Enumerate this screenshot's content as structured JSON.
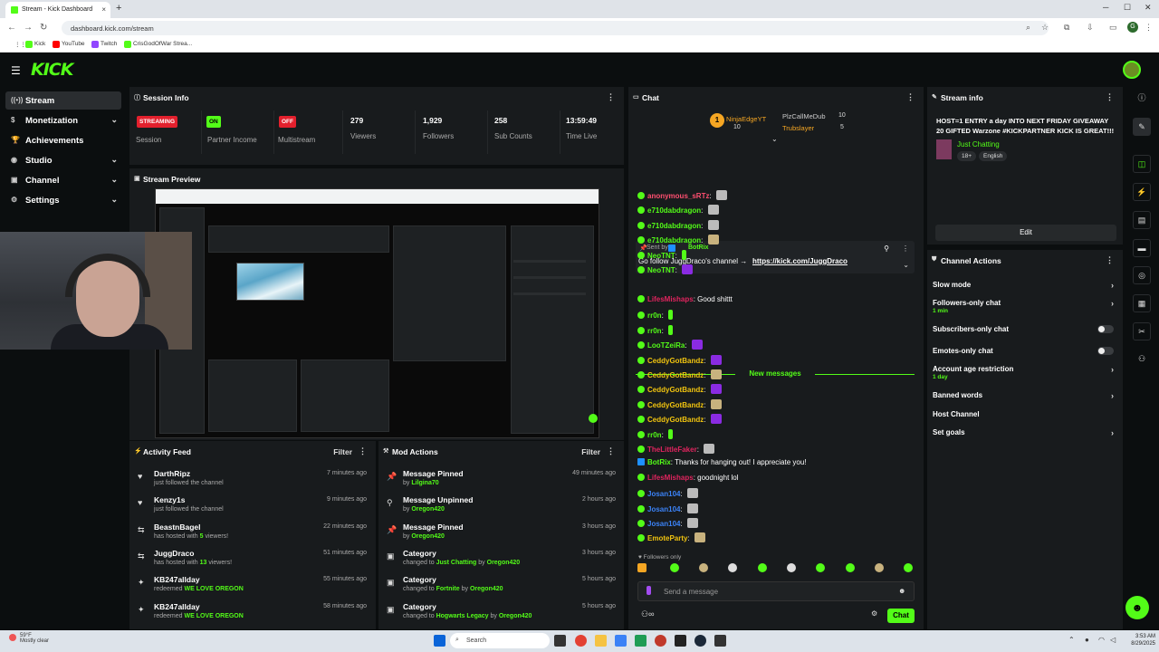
{
  "browser": {
    "tab_title": "Stream - Kick Dashboard",
    "tab_close": "×",
    "new_tab": "+",
    "url": "dashboard.kick.com/stream",
    "bookmarks": [
      "Kick",
      "YouTube",
      "Twitch",
      "CrisGodOfWar Strea..."
    ]
  },
  "app": {
    "logo": "KICK"
  },
  "sidebar": {
    "items": [
      {
        "label": "Stream",
        "active": true
      },
      {
        "label": "Monetization"
      },
      {
        "label": "Achievements"
      },
      {
        "label": "Studio"
      },
      {
        "label": "Channel"
      },
      {
        "label": "Settings"
      }
    ]
  },
  "session_info": {
    "title": "Session Info",
    "streaming_badge": "STREAMING",
    "session_label": "Session",
    "partner_badge": "ON",
    "partner_label": "Partner Income",
    "multistream_badge": "OFF",
    "multistream_label": "Multistream",
    "viewers": "279",
    "viewers_label": "Viewers",
    "followers": "1,929",
    "followers_label": "Followers",
    "subs": "258",
    "subs_label": "Sub Counts",
    "time_live": "13:59:49",
    "time_live_label": "Time Live"
  },
  "stream_preview": {
    "title": "Stream Preview"
  },
  "activity_feed": {
    "title": "Activity Feed",
    "filter": "Filter",
    "items": [
      {
        "name": "DarthRipz",
        "sub": "just followed the channel",
        "time": "7 minutes ago",
        "icon": "heart-icon"
      },
      {
        "name": "Kenzy1s",
        "sub": "just followed the channel",
        "time": "9 minutes ago",
        "icon": "heart-icon"
      },
      {
        "name": "BeastnBagel",
        "sub_pre": "has hosted with ",
        "sub_hl": "5",
        "sub_post": " viewers!",
        "time": "22 minutes ago",
        "icon": "host-icon"
      },
      {
        "name": "JuggDraco",
        "sub_pre": "has hosted with ",
        "sub_hl": "13",
        "sub_post": " viewers!",
        "time": "51 minutes ago",
        "icon": "host-icon"
      },
      {
        "name": "KB247allday",
        "sub_pre": "redeemed ",
        "sub_hl": "WE LOVE OREGON",
        "sub_post": "",
        "time": "55 minutes ago",
        "icon": "redeem-icon"
      },
      {
        "name": "KB247allday",
        "sub_pre": "redeemed ",
        "sub_hl": "WE LOVE OREGON",
        "sub_post": "",
        "time": "58 minutes ago",
        "icon": "redeem-icon"
      }
    ]
  },
  "mod_actions": {
    "title": "Mod Actions",
    "filter": "Filter",
    "items": [
      {
        "name": "Message Pinned",
        "pre": "by ",
        "hl": "Lilgina70",
        "mid": "",
        "hl2": "",
        "time": "49 minutes ago"
      },
      {
        "name": "Message Unpinned",
        "pre": "by ",
        "hl": "Oregon420",
        "mid": "",
        "hl2": "",
        "time": "2 hours ago"
      },
      {
        "name": "Message Pinned",
        "pre": "by ",
        "hl": "Oregon420",
        "mid": "",
        "hl2": "",
        "time": "3 hours ago"
      },
      {
        "name": "Category",
        "pre": "changed to ",
        "hl": "Just Chatting",
        "mid": " by ",
        "hl2": "Oregon420",
        "time": "3 hours ago"
      },
      {
        "name": "Category",
        "pre": "changed to ",
        "hl": "Fortnite",
        "mid": " by ",
        "hl2": "Oregon420",
        "time": "5 hours ago"
      },
      {
        "name": "Category",
        "pre": "changed to ",
        "hl": "Hogwarts Legacy",
        "mid": " by ",
        "hl2": "Oregon420",
        "time": "5 hours ago"
      }
    ]
  },
  "chat": {
    "title": "Chat",
    "leaderboard": [
      {
        "rank": "1",
        "name": "NinjaEdgeYT",
        "count": "10"
      },
      {
        "name": "PlzCallMeDub",
        "count": "10"
      },
      {
        "name": "Trubslayer",
        "count": "5"
      }
    ],
    "pinned_sent_by_label": "Sent by",
    "pinned_sender": "BotRix",
    "pinned_text": "Go follow JuggDraco's channel → ",
    "pinned_link": "https://kick.com/JuggDraco",
    "messages_before": [
      {
        "user": "anonymous_sRTz",
        "color": "#ff4f70",
        "emote": "gr"
      },
      {
        "user": "e710dabdragon",
        "color": "#53fc18",
        "emote": "gr"
      },
      {
        "user": "e710dabdragon",
        "color": "#53fc18",
        "emote": "gr"
      },
      {
        "user": "e710dabdragon",
        "color": "#53fc18",
        "emote": "y"
      },
      {
        "user": "NeoTNT",
        "color": "#53fc18",
        "emote": "g"
      },
      {
        "user": "NeoTNT",
        "color": "#53fc18",
        "emote": "pp"
      }
    ],
    "new_messages_label": "New messages",
    "messages": [
      {
        "user": "LifesMishaps",
        "color": "#e0245e",
        "text": "Good shittt",
        "emote": ""
      },
      {
        "user": "rr0n",
        "color": "#53fc18",
        "text": "",
        "emote": "g"
      },
      {
        "user": "rr0n",
        "color": "#53fc18",
        "text": "",
        "emote": "g"
      },
      {
        "user": "LooTZeiRa",
        "color": "#53fc18",
        "text": "",
        "emote": "pp"
      },
      {
        "user": "CeddyGotBandz",
        "color": "#f1c40f",
        "text": "",
        "emote": "pp"
      },
      {
        "user": "CeddyGotBandz",
        "color": "#f1c40f",
        "text": "",
        "emote": "y"
      },
      {
        "user": "CeddyGotBandz",
        "color": "#f1c40f",
        "text": "",
        "emote": "pp"
      },
      {
        "user": "CeddyGotBandz",
        "color": "#f1c40f",
        "text": "",
        "emote": "y"
      },
      {
        "user": "CeddyGotBandz",
        "color": "#f1c40f",
        "text": "",
        "emote": "pp"
      },
      {
        "user": "rr0n",
        "color": "#53fc18",
        "text": "",
        "emote": "g"
      },
      {
        "user": "TheLittleFaker",
        "color": "#e0245e",
        "text": "",
        "emote": "gr"
      },
      {
        "user": "BotRix",
        "color": "#53fc18",
        "text": "Thanks for hanging out! I appreciate you!",
        "emote": ""
      },
      {
        "user": "LifesMishaps",
        "color": "#e0245e",
        "text": "goodnight lol",
        "emote": ""
      },
      {
        "user": "Josan104",
        "color": "#3b82f6",
        "text": "",
        "emote": "gr"
      },
      {
        "user": "Josan104",
        "color": "#3b82f6",
        "text": "",
        "emote": "gr"
      },
      {
        "user": "Josan104",
        "color": "#3b82f6",
        "text": "",
        "emote": "gr"
      },
      {
        "user": "EmoteParty",
        "color": "#f1c40f",
        "text": "",
        "emote": "y"
      }
    ],
    "followers_only": "Followers only",
    "input_placeholder": "Send a message",
    "chat_button": "Chat"
  },
  "stream_info": {
    "title": "Stream info",
    "stream_title": "HOST=1 ENTRY a day INTO NEXT FRIDAY GIVEAWAY 20 GIFTED Warzone #KICKPARTNER KICK IS GREAT!!!",
    "category": "Just Chatting",
    "tags": [
      "18+",
      "English"
    ],
    "edit": "Edit"
  },
  "channel_actions": {
    "title": "Channel Actions",
    "items": [
      {
        "label": "Slow mode",
        "type": "chev",
        "sub": ""
      },
      {
        "label": "Followers-only chat",
        "type": "chev",
        "sub": "1 min"
      },
      {
        "label": "Subscribers-only chat",
        "type": "toggle",
        "sub": ""
      },
      {
        "label": "Emotes-only chat",
        "type": "toggle",
        "sub": ""
      },
      {
        "label": "Account age restriction",
        "type": "chev",
        "sub": "1 day"
      },
      {
        "label": "Banned words",
        "type": "chev",
        "sub": ""
      },
      {
        "label": "Host Channel",
        "type": "none",
        "sub": ""
      },
      {
        "label": "Set goals",
        "type": "chev",
        "sub": ""
      }
    ]
  },
  "taskbar": {
    "temp": "59°F",
    "weather": "Mostly clear",
    "search": "Search",
    "time": "3:53 AM",
    "date": "8/29/2025"
  },
  "colors": {
    "accent": "#53fc18",
    "bg": "#0b0e0f",
    "panel": "#181b1d",
    "live_red": "#e3202d"
  }
}
